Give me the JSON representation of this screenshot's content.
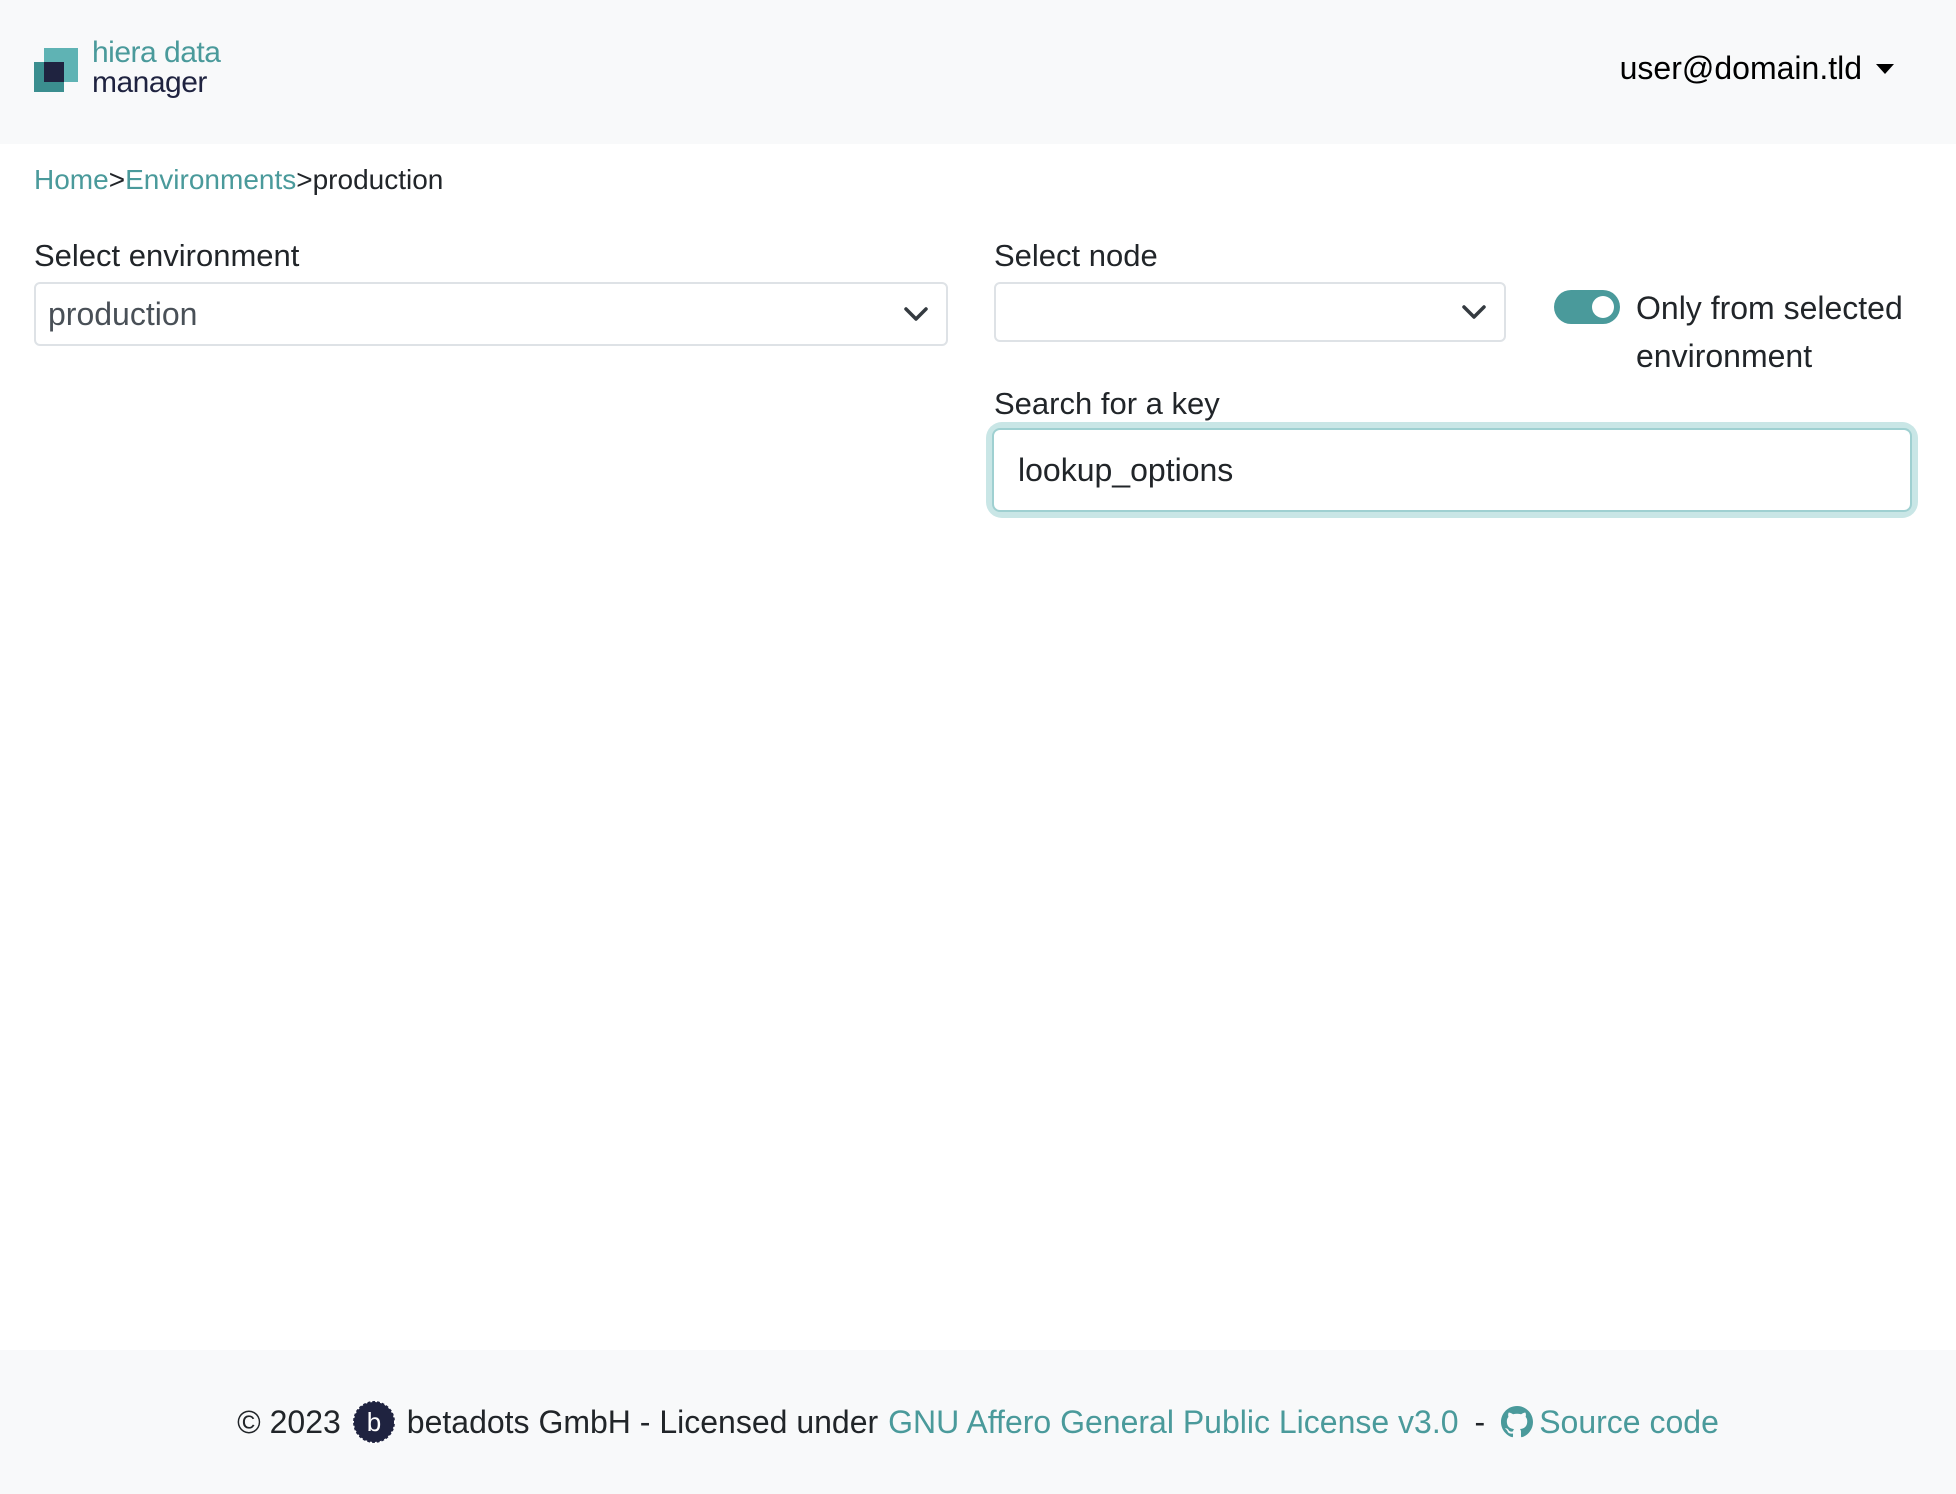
{
  "header": {
    "logo_line1": "hiera data",
    "logo_line2": "manager",
    "user_email": "user@domain.tld"
  },
  "breadcrumb": {
    "home": "Home",
    "sep1": ">",
    "environments": "Environments",
    "sep2": ">",
    "current": "production"
  },
  "form": {
    "environment_label": "Select environment",
    "environment_value": "production",
    "node_label": "Select node",
    "node_value": "",
    "toggle_label": "Only from selected environment",
    "toggle_on": true,
    "search_label": "Search for a key",
    "search_value": "lookup_options"
  },
  "footer": {
    "copyright": "© 2023",
    "company": "betadots GmbH - Licensed under",
    "license_link": "GNU Affero General Public License v3.0",
    "dash": "-",
    "source_link": "Source code"
  },
  "colors": {
    "accent": "#4a9a9b",
    "navy": "#1f2340",
    "header_bg": "#f8f9fa"
  }
}
